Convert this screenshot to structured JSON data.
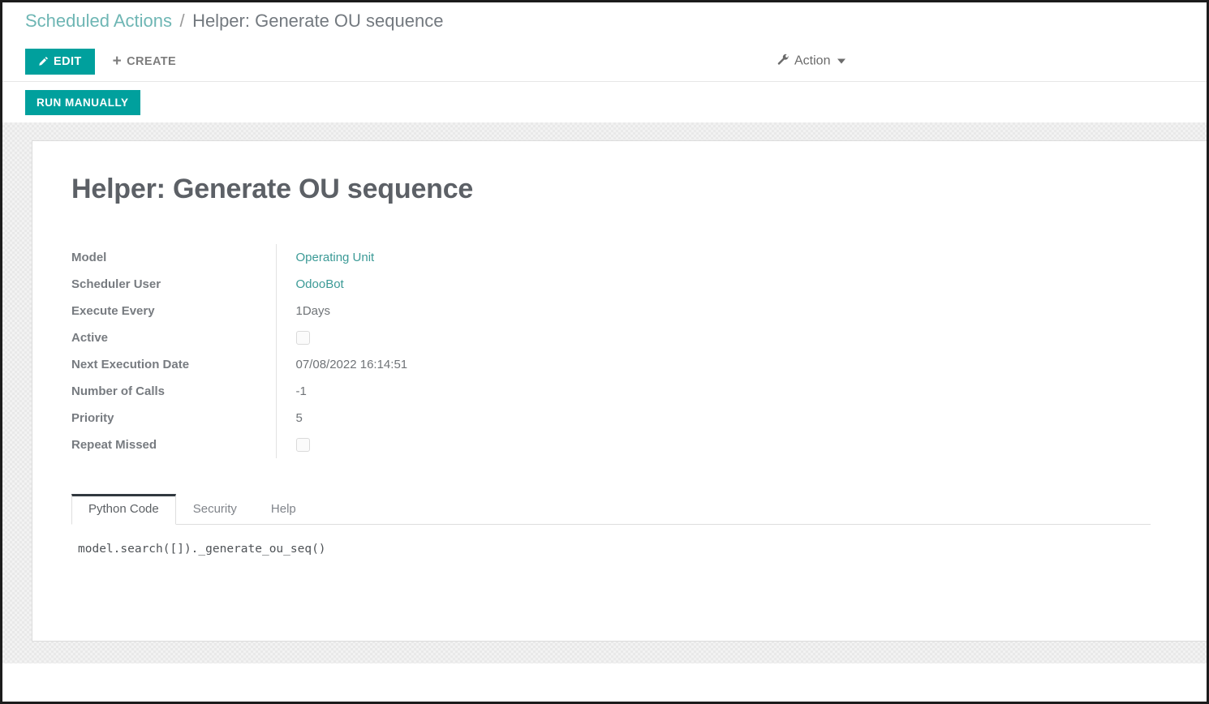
{
  "breadcrumb": {
    "root": "Scheduled Actions",
    "separator": "/",
    "current": "Helper: Generate OU sequence"
  },
  "toolbar": {
    "edit_label": "EDIT",
    "create_label": "CREATE",
    "create_icon": "plus-icon",
    "edit_icon": "pencil-icon",
    "action_label": "Action",
    "action_icon": "wrench-icon",
    "run_manually_label": "RUN MANUALLY"
  },
  "record": {
    "title": "Helper: Generate OU sequence",
    "fields": [
      {
        "label": "Model",
        "value": "Operating Unit",
        "type": "link"
      },
      {
        "label": "Scheduler User",
        "value": "OdooBot",
        "type": "link"
      },
      {
        "label": "Execute Every",
        "value": "1Days",
        "type": "text"
      },
      {
        "label": "Active",
        "value": "",
        "type": "checkbox",
        "checked": false
      },
      {
        "label": "Next Execution Date",
        "value": "07/08/2022 16:14:51",
        "type": "text"
      },
      {
        "label": "Number of Calls",
        "value": "-1",
        "type": "text"
      },
      {
        "label": "Priority",
        "value": "5",
        "type": "text"
      },
      {
        "label": "Repeat Missed",
        "value": "",
        "type": "checkbox",
        "checked": false
      }
    ]
  },
  "notebook": {
    "tabs": [
      {
        "label": "Python Code",
        "active": true
      },
      {
        "label": "Security",
        "active": false
      },
      {
        "label": "Help",
        "active": false
      }
    ],
    "python_code": "model.search([])._generate_ou_seq()"
  },
  "colors": {
    "accent_teal": "#00a09d",
    "link_teal": "#3b9a96",
    "breadcrumb_link": "#6eb6b4",
    "label_gray": "#777b80",
    "tab_active_border": "#31393f"
  }
}
